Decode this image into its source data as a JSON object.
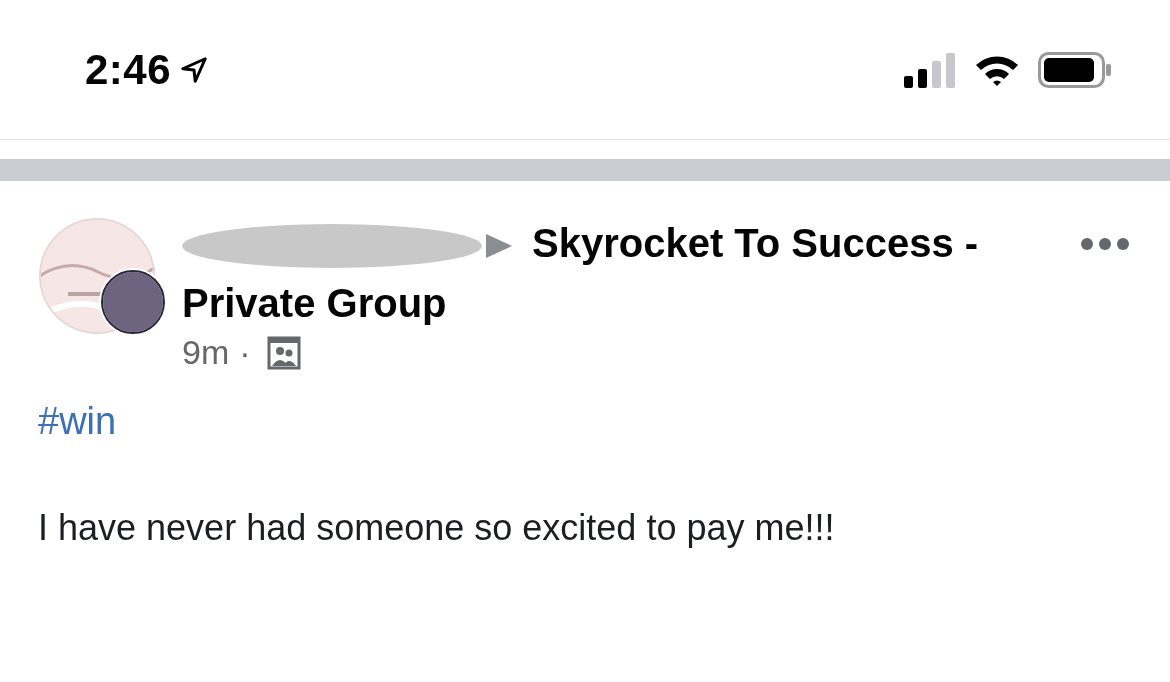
{
  "status_bar": {
    "time": "2:46"
  },
  "post": {
    "group_name_lines": [
      "Skyrocket To Success -",
      "Private Group"
    ],
    "time": "9m",
    "separator": "·",
    "hashtag": "#win",
    "body": "I have never had someone so excited to pay me!!!"
  }
}
